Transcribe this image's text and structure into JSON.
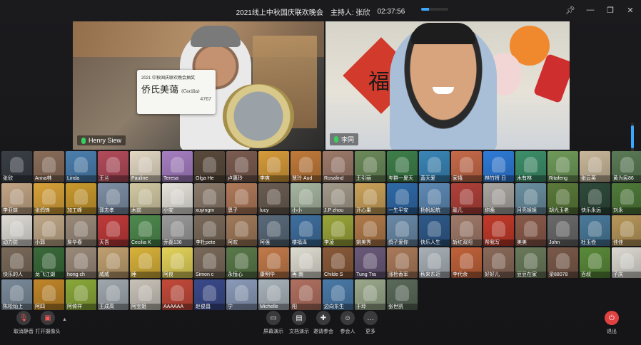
{
  "title_bar": {
    "title": "2021线上中秋国庆联欢晚会",
    "host": "主持人: 张欣",
    "timer": "02:37:56",
    "progress": 0.3
  },
  "window_controls": [
    "pin-icon",
    "minimize-icon",
    "restore-icon",
    "close-icon"
  ],
  "speakers": [
    {
      "name": "Henry Siew",
      "mic_color": "#38d160"
    },
    {
      "name": "李同",
      "mic_color": "#38d160"
    }
  ],
  "card": {
    "top": "2021 中秋国庆联欢晚会抽奖",
    "name": "侨氏美蔼",
    "english": "(Cecilia)",
    "number": "4767"
  },
  "right_video": {
    "fu": "福"
  },
  "participants": [
    {
      "name": "张欣",
      "color": "#3a3f46"
    },
    {
      "name": "Anna林",
      "color": "#8a6d5a"
    },
    {
      "name": "Linda",
      "color": "#4b7fae"
    },
    {
      "name": "王兰",
      "color": "#b24b5a"
    },
    {
      "name": "Pauline",
      "color": "#e2d7c3"
    },
    {
      "name": "Teresa",
      "color": "#a67ec2"
    },
    {
      "name": "Olga He",
      "color": "#5a4a3c"
    },
    {
      "name": "卢惠玲",
      "color": "#7b5c50"
    },
    {
      "name": "李爽",
      "color": "#d69b3a"
    },
    {
      "name": "慧玲 Aud",
      "color": "#c07a3a"
    },
    {
      "name": "Rosalind",
      "color": "#9d7a6a"
    },
    {
      "name": "王引丽",
      "color": "#6c8a5a"
    },
    {
      "name": "岑群一夏天",
      "color": "#3e7f4a"
    },
    {
      "name": "蓝天爱",
      "color": "#3a86b7"
    },
    {
      "name": "家禧",
      "color": "#c66a4a"
    },
    {
      "name": "林竹将 日",
      "color": "#2f7bd8"
    },
    {
      "name": "木有林",
      "color": "#3d8f6a"
    },
    {
      "name": "Ritafeng",
      "color": "#6f9a5a"
    },
    {
      "name": "张云英",
      "color": "#c8b79a"
    },
    {
      "name": "黄为民86",
      "color": "#5a7a55"
    },
    {
      "name": "李亚妹",
      "color": "#c2a585"
    },
    {
      "name": "张鸽锋",
      "color": "#d8a23a"
    },
    {
      "name": "加工峰",
      "color": "#c99a2e"
    },
    {
      "name": "郭志孝",
      "color": "#7e8fa5"
    },
    {
      "name": "木前",
      "color": "#d2c9a3"
    },
    {
      "name": "小安",
      "color": "#e6e3dc"
    },
    {
      "name": "xuyingm",
      "color": "#8a7a6a"
    },
    {
      "name": "恩子",
      "color": "#b07a5a"
    },
    {
      "name": "lucy",
      "color": "#6a5d52"
    },
    {
      "name": "小小",
      "color": "#a6b6a0"
    },
    {
      "name": "J.P zhou",
      "color": "#a29a8a"
    },
    {
      "name": "开心果",
      "color": "#caa25a"
    },
    {
      "name": "一生平安",
      "color": "#2f6aa8"
    },
    {
      "name": "扬帆起航",
      "color": "#5e8ab5"
    },
    {
      "name": "龍几",
      "color": "#b0413a"
    },
    {
      "name": "你晚",
      "color": "#a9a5a0"
    },
    {
      "name": "月亮姐姐",
      "color": "#6a8fa0"
    },
    {
      "name": "胡光玉老",
      "color": "#5a7a3a"
    },
    {
      "name": "快乐永远",
      "color": "#2e4a3a"
    },
    {
      "name": "刘永",
      "color": "#4f7a3a"
    },
    {
      "name": "动力防",
      "color": "#dedbd5"
    },
    {
      "name": "小郭",
      "color": "#c0a888"
    },
    {
      "name": "詹华春",
      "color": "#9a8a7a"
    },
    {
      "name": "天吾",
      "color": "#c03a3a"
    },
    {
      "name": "Cecilia K",
      "color": "#4e8a4e"
    },
    {
      "name": "乔磊136",
      "color": "#9a9a9a"
    },
    {
      "name": "李杜pete",
      "color": "#7a6a5a"
    },
    {
      "name": "阿欢",
      "color": "#a07a5a"
    },
    {
      "name": "阿强",
      "color": "#5a6a7a"
    },
    {
      "name": "楼福泽",
      "color": "#3f6f9f"
    },
    {
      "name": "李凌",
      "color": "#9aa53a"
    },
    {
      "name": "姚美秀",
      "color": "#b07a4a"
    },
    {
      "name": "鸽子爱你",
      "color": "#6a8aa8"
    },
    {
      "name": "快乐人生",
      "color": "#2f5a8a"
    },
    {
      "name": "斩红双阳",
      "color": "#a07a6a"
    },
    {
      "name": "帮我写",
      "color": "#c23a2a"
    },
    {
      "name": "美美",
      "color": "#8a5a4a"
    },
    {
      "name": "John",
      "color": "#6a6a6a"
    },
    {
      "name": "杜玉俭",
      "color": "#4a7a9a"
    },
    {
      "name": "佳佳",
      "color": "#b7975a"
    },
    {
      "name": "快乐的人",
      "color": "#7a6a5a"
    },
    {
      "name": "龙飞江湖",
      "color": "#3a6a3a"
    },
    {
      "name": "hong ch",
      "color": "#9a8a7a"
    },
    {
      "name": "威威",
      "color": "#c0a070"
    },
    {
      "name": "睡",
      "color": "#d8b23a"
    },
    {
      "name": "阿良",
      "color": "#e2d25a"
    },
    {
      "name": "Simon c",
      "color": "#7a6a5a"
    },
    {
      "name": "永恒心",
      "color": "#5a7a4a"
    },
    {
      "name": "康明华",
      "color": "#c27a4a"
    },
    {
      "name": "再 南",
      "color": "#dedbd0"
    },
    {
      "name": "Childe S",
      "color": "#8a5a3a"
    },
    {
      "name": "Tung Tra",
      "color": "#6a5a7a"
    },
    {
      "name": "涨检香军",
      "color": "#aa7a5a"
    },
    {
      "name": "秋来东近",
      "color": "#a8b0b6"
    },
    {
      "name": "李代余",
      "color": "#c0623a"
    },
    {
      "name": "好好儿",
      "color": "#8a6a5a"
    },
    {
      "name": "豆豆在家",
      "color": "#6a7a5a"
    },
    {
      "name": "梁88078",
      "color": "#7a5a4a"
    },
    {
      "name": "百叔",
      "color": "#5a8a3a"
    },
    {
      "name": "子庆",
      "color": "#dad8d0"
    },
    {
      "name": "陈松灿上",
      "color": "#7a8a9a"
    },
    {
      "name": "阿四",
      "color": "#c0862a"
    },
    {
      "name": "阿倚祥",
      "color": "#8aa83a"
    },
    {
      "name": "王成高",
      "color": "#a0a8ae"
    },
    {
      "name": "阿宝姐",
      "color": "#c8c2b8"
    },
    {
      "name": "AAAAAA",
      "color": "#c24a3a"
    },
    {
      "name": "赵俊昌",
      "color": "#3a4a8a"
    },
    {
      "name": "宁",
      "color": "#8a9ab8"
    },
    {
      "name": "Michelle",
      "color": "#a8b2ba"
    },
    {
      "name": "阳",
      "color": "#b07060"
    },
    {
      "name": "边向东生",
      "color": "#4a7aa8"
    },
    {
      "name": "于玲",
      "color": "#9aa88a"
    },
    {
      "name": "张世凯",
      "color": "#5a6a5a"
    }
  ],
  "toolbar": {
    "unmute": "取消静音",
    "camera": "打开摄像头",
    "share": "屏幕演示",
    "doc": "文档演示",
    "invite": "邀请参会",
    "participants": "参会人",
    "more": "更多",
    "leave": "退出"
  }
}
